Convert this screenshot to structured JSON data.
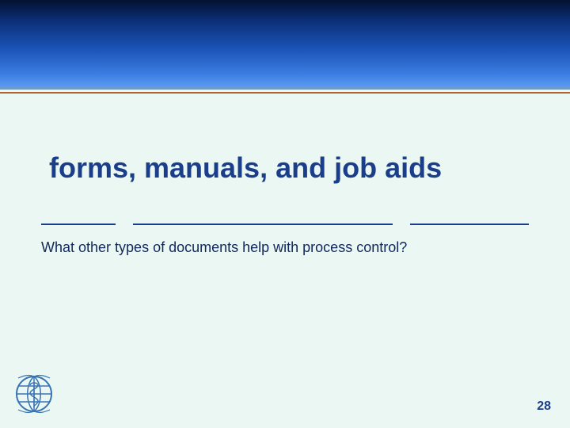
{
  "title": "forms, manuals, and job aids",
  "body": "What other types of documents help with process control?",
  "page_number": "28",
  "colors": {
    "accent": "#1b3e8a",
    "background": "#eaf7f3",
    "rule_orange": "#b2622b"
  },
  "logo": {
    "name": "who-logo",
    "alt": "World Health Organization emblem"
  }
}
